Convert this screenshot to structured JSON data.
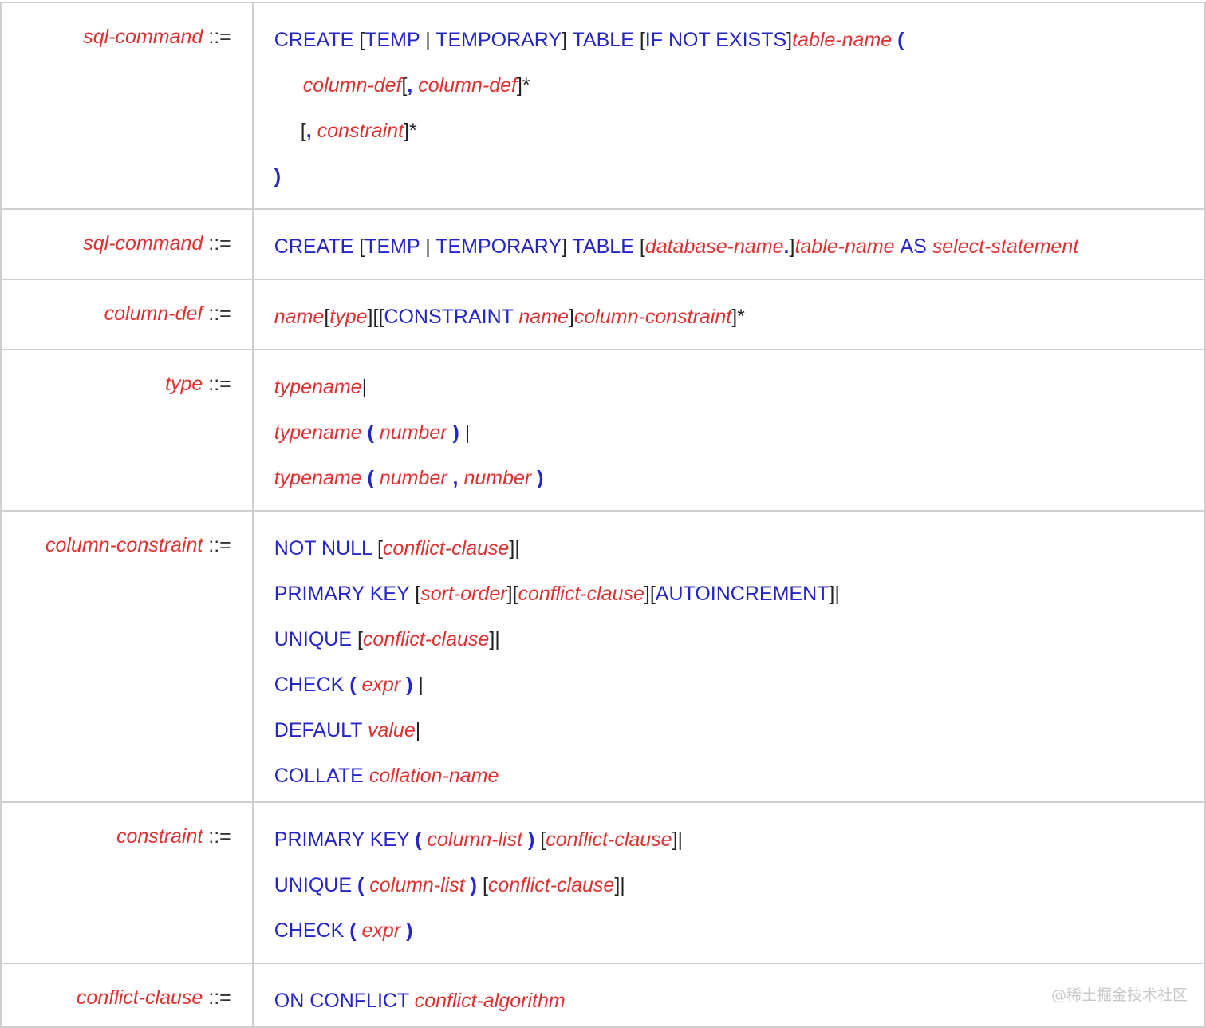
{
  "define_op": "::=",
  "rules": [
    {
      "name": "sql-command",
      "lines": [
        [
          [
            "kw",
            "CREATE "
          ],
          [
            "op",
            "["
          ],
          [
            "kw",
            "TEMP "
          ],
          [
            "op",
            "| "
          ],
          [
            "kw",
            "TEMPORARY"
          ],
          [
            "op",
            "] "
          ],
          [
            "kw",
            "TABLE "
          ],
          [
            "op",
            "["
          ],
          [
            "kw",
            "IF NOT EXISTS"
          ],
          [
            "op",
            "]"
          ],
          [
            "nt",
            "table-name "
          ],
          [
            "sym",
            "("
          ]
        ],
        [
          [
            "nt",
            "column-def"
          ],
          [
            "op",
            "["
          ],
          [
            "sym",
            ","
          ],
          [
            "nt",
            " column-def"
          ],
          [
            "op",
            "]*"
          ]
        ],
        [
          [
            "op",
            "["
          ],
          [
            "sym",
            ","
          ],
          [
            "nt",
            " constraint"
          ],
          [
            "op",
            "]*"
          ]
        ],
        [
          [
            "sym",
            ")"
          ]
        ]
      ]
    },
    {
      "name": "sql-command",
      "lines": [
        [
          [
            "kw",
            "CREATE "
          ],
          [
            "op",
            "["
          ],
          [
            "kw",
            "TEMP "
          ],
          [
            "op",
            "| "
          ],
          [
            "kw",
            "TEMPORARY"
          ],
          [
            "op",
            "] "
          ],
          [
            "kw",
            "TABLE "
          ],
          [
            "op",
            "["
          ],
          [
            "nt",
            "database-name"
          ],
          [
            "sym",
            "."
          ],
          [
            "op",
            "]"
          ],
          [
            "nt",
            "table-name "
          ],
          [
            "kw",
            "AS "
          ],
          [
            "nt",
            "select-statement"
          ]
        ]
      ]
    },
    {
      "name": "column-def",
      "lines": [
        [
          [
            "nt",
            "name"
          ],
          [
            "op",
            "["
          ],
          [
            "nt",
            "type"
          ],
          [
            "op",
            "]["
          ],
          [
            "op",
            "["
          ],
          [
            "kw",
            "CONSTRAINT "
          ],
          [
            "nt",
            "name"
          ],
          [
            "op",
            "]"
          ],
          [
            "nt",
            "column-constraint"
          ],
          [
            "op",
            "]*"
          ]
        ]
      ]
    },
    {
      "name": "type",
      "lines": [
        [
          [
            "nt",
            "typename"
          ],
          [
            "op",
            "|"
          ]
        ],
        [
          [
            "nt",
            "typename "
          ],
          [
            "sym",
            "( "
          ],
          [
            "nt",
            "number "
          ],
          [
            "sym",
            ")"
          ],
          [
            "op",
            " |"
          ]
        ],
        [
          [
            "nt",
            "typename "
          ],
          [
            "sym",
            "( "
          ],
          [
            "nt",
            "number "
          ],
          [
            "sym",
            ", "
          ],
          [
            "nt",
            "number "
          ],
          [
            "sym",
            ")"
          ]
        ]
      ]
    },
    {
      "name": "column-constraint",
      "lines": [
        [
          [
            "kw",
            "NOT NULL "
          ],
          [
            "op",
            "["
          ],
          [
            "nt",
            "conflict-clause"
          ],
          [
            "op",
            "]|"
          ]
        ],
        [
          [
            "kw",
            "PRIMARY KEY "
          ],
          [
            "op",
            "["
          ],
          [
            "nt",
            "sort-order"
          ],
          [
            "op",
            "]["
          ],
          [
            "nt",
            "conflict-clause"
          ],
          [
            "op",
            "]["
          ],
          [
            "kw",
            "AUTOINCREMENT"
          ],
          [
            "op",
            "]|"
          ]
        ],
        [
          [
            "kw",
            "UNIQUE "
          ],
          [
            "op",
            "["
          ],
          [
            "nt",
            "conflict-clause"
          ],
          [
            "op",
            "]|"
          ]
        ],
        [
          [
            "kw",
            "CHECK "
          ],
          [
            "sym",
            "( "
          ],
          [
            "nt",
            "expr "
          ],
          [
            "sym",
            ")"
          ],
          [
            "op",
            " |"
          ]
        ],
        [
          [
            "kw",
            "DEFAULT "
          ],
          [
            "nt",
            "value"
          ],
          [
            "op",
            "|"
          ]
        ],
        [
          [
            "kw",
            "COLLATE "
          ],
          [
            "nt",
            "collation-name"
          ]
        ]
      ]
    },
    {
      "name": "constraint",
      "lines": [
        [
          [
            "kw",
            "PRIMARY KEY "
          ],
          [
            "sym",
            "( "
          ],
          [
            "nt",
            "column-list "
          ],
          [
            "sym",
            ")"
          ],
          [
            "op",
            " ["
          ],
          [
            "nt",
            "conflict-clause"
          ],
          [
            "op",
            "]|"
          ]
        ],
        [
          [
            "kw",
            "UNIQUE "
          ],
          [
            "sym",
            "( "
          ],
          [
            "nt",
            "column-list "
          ],
          [
            "sym",
            ")"
          ],
          [
            "op",
            " ["
          ],
          [
            "nt",
            "conflict-clause"
          ],
          [
            "op",
            "]|"
          ]
        ],
        [
          [
            "kw",
            "CHECK "
          ],
          [
            "sym",
            "( "
          ],
          [
            "nt",
            "expr "
          ],
          [
            "sym",
            ")"
          ]
        ]
      ]
    },
    {
      "name": "conflict-clause",
      "lines": [
        [
          [
            "kw",
            "ON CONFLICT "
          ],
          [
            "nt",
            "conflict-algorithm"
          ]
        ]
      ]
    }
  ],
  "watermark": "@稀土掘金技术社区"
}
